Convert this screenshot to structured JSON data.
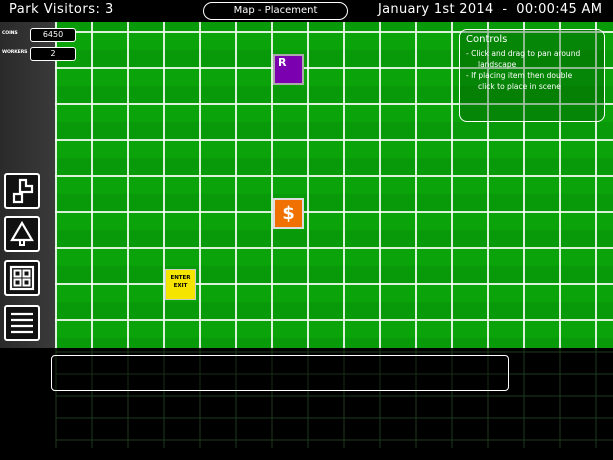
{
  "hud": {
    "visitors_text": "Park Visitors: 3",
    "mode_text": "Map - Placement",
    "datetime_text": "January 1st 2014  -  00:00:45 AM"
  },
  "stats": {
    "coins_label": "COINS",
    "coins_value": "6450",
    "workers_label": "WORKERS",
    "workers_value": "2"
  },
  "tools": [
    {
      "name": "path-tool",
      "icon": "path-icon"
    },
    {
      "name": "tree-tool",
      "icon": "tree-icon"
    },
    {
      "name": "grid-tool",
      "icon": "grid-icon"
    },
    {
      "name": "menu-tool",
      "icon": "menu-icon"
    }
  ],
  "controls": {
    "title": "Controls",
    "line1": "- Click and drag to pan around",
    "line2": "landscape",
    "line3": "- If placing item then double",
    "line4": "click to place in scene"
  },
  "items": {
    "ride_label": "R",
    "shop_label": "$",
    "gate_line1": "ENTER",
    "gate_line2": "EXIT"
  },
  "colors": {
    "grass": "#0aa00a",
    "grid_line": "#ffffff",
    "ride": "#7a00b0",
    "shop": "#f07000",
    "gate": "#f5e400"
  }
}
